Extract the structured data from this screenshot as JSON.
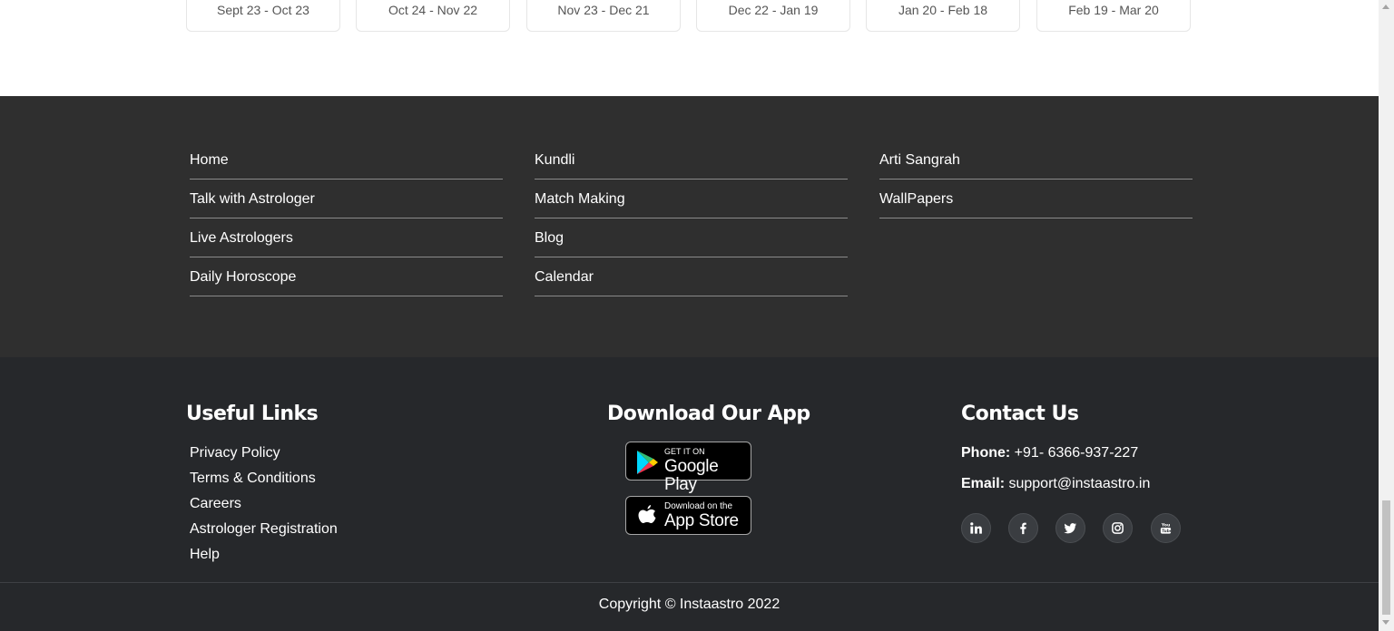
{
  "zodiac_dates": [
    "Sept 23 - Oct 23",
    "Oct 24 - Nov 22",
    "Nov 23 - Dec 21",
    "Dec 22 - Jan 19",
    "Jan 20 - Feb 18",
    "Feb 19 - Mar 20"
  ],
  "nav_links": {
    "col1": [
      "Home",
      "Talk with Astrologer",
      "Live Astrologers",
      "Daily Horoscope"
    ],
    "col2": [
      "Kundli",
      "Match Making",
      "Blog",
      "Calendar"
    ],
    "col3": [
      "Arti Sangrah",
      "WallPapers"
    ]
  },
  "footer": {
    "useful_links_title": "Useful Links",
    "useful_links": [
      "Privacy Policy",
      "Terms & Conditions",
      "Careers",
      "Astrologer Registration",
      "Help"
    ],
    "download_title": "Download Our App",
    "google_play": {
      "small": "GET IT ON",
      "big": "Google Play"
    },
    "app_store": {
      "small": "Download on the",
      "big": "App Store"
    },
    "contact_title": "Contact Us",
    "phone_label": "Phone:",
    "phone_value": "+91- 6366-937-227",
    "email_label": "Email:",
    "email_value": "support@instaastro.in",
    "social_icons": [
      "linkedin-icon",
      "facebook-icon",
      "twitter-icon",
      "instagram-icon",
      "youtube-icon"
    ],
    "copyright": "Copyright © Instaastro 2022"
  },
  "colors": {
    "links_band_bg": "#2f2f2f",
    "footer_bg": "#26282b",
    "text": "#ffffff"
  }
}
